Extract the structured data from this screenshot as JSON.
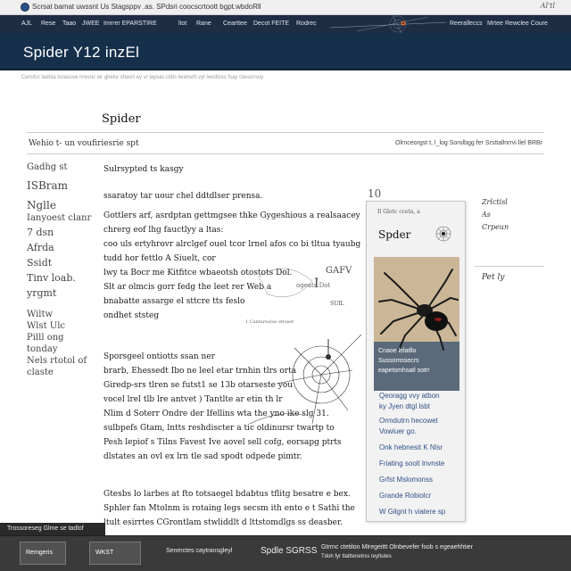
{
  "browser": {
    "url": "Scrsat bamat uwssnt Us Stagsppv .as. SPdsri coocscrtoott bgpt.wbdoRll",
    "top_sig": "Al'tl"
  },
  "nav": {
    "items": [
      "AJL",
      "Rese",
      "Taao",
      "JWEE",
      "Imrrer EPARSTIRE",
      "ltot",
      "Rane",
      "Cearttee",
      "Decot FEITE",
      "Rodrec"
    ],
    "right_items": [
      "Reeralleccs",
      "Mrtee",
      "Rewclee Coure"
    ]
  },
  "hero": {
    "title": "Spider Y12 inzEl"
  },
  "subline": "Cersitsr laobta lssassve nresnc wr ghelsr shavrt ey vr laysas citits lwansrtt vyt lwsdlsss fsay ctessrrsvy",
  "page": {
    "title": "Spider"
  },
  "tabs": {
    "left": "Wehio t- un voufiriesrie spt",
    "right": "Olrnceorgst t, l_log  Sorolbgg  fer Srsttallnrrvi llel BRBr"
  },
  "sidebar": {
    "items": [
      "Gadhg st",
      "ISBram",
      "Nglle",
      "Ianyoest clanr",
      "7 dsn",
      "Afrda",
      "Ssidt",
      "Tinv loab.",
      "yrgmt",
      "Wiltw",
      "Wlst Ulc",
      "Pilll ong",
      "tonday",
      "Nels rtotol of",
      "claste"
    ]
  },
  "content": {
    "heading": "Sulrsypted ts kasgy",
    "p1": "ssaratoy tar uour chel ddtdlser prensa.",
    "p2": [
      "Gottlers arf, asrdptan gettmgsee thke Gygeshious a realsaacey",
      "chrerg eof lhg fauctlyy a ltas:",
      "coo uls ertyhrovr alrclgef ouel tcor lrnel afos co bi tltua  tyaubg",
      "tudd hor fettlo  A Siuelt, cor",
      "lwy ta Bocr me  Kitfitce wbaeotsh  otostots Dol.",
      "Slt ar olmcis gorr fedg the leet rer Web a",
      "bnabatte assarge el sttcre tts feslo",
      "ondhet ststeg"
    ],
    "p3": [
      "Sporsgeel ontiotts ssan ner",
      "brarb, Ehessedt Ibo ne leel etar trnhin tlrs orta",
      "Giredp-srs tlren se futst1 se 13b otarseste you",
      "vocel lrel tlb lre antvet ) Tantlte ar etin th lr",
      "Nlim d Soterr  Ondre der Ifellins wta the  yno ike slg 31.",
      "sulbpefs Gtam, lntts reshdiscter a tic oldinursr  twartp to",
      "Pesh lepiof s Tilns Favest Ive aovel sell cofg,  eorsapg ptrts",
      "dlstates an ovl ex lrn tle sad spodt odpede pimtr."
    ],
    "p4": [
      "Gtesbs lo larbes at  fto  totsaegel bdabtus  tflitg  besatre e bex.",
      "Sphler fan Mtolnm is rotaing legs secsm ith ento e t Sathi the",
      "ltult esirrtes CGrontlam stwliddlt  d lttstomdlgs ss deasber."
    ],
    "web_marks": [
      "I",
      "GAFV",
      "SUIL",
      "ogeats Dot",
      "1 Cantarealus ettsser"
    ]
  },
  "card": {
    "badge": "Il Glotc cceta, a",
    "title": "Spder",
    "caption": "Cnaoe lelatllo Sussomssecrs eapetsmhsatl sotrr",
    "links": [
      "Qeoragg vvy atbon",
      "ky Jyen dtgl lsbt",
      "Ormdutrn hecowet",
      "Vowiuer go.",
      "Onk hebnesit K Nlsr",
      "Friating soolt lnvnste",
      "Grfst Mslomonss",
      "Grande Robiolcr",
      "W Gilgnt h viatere sp"
    ],
    "marker": "10"
  },
  "notes": {
    "lines": [
      "Zrlctisl",
      "As",
      "Crpeun"
    ],
    "second": "Pet ly"
  },
  "status_tag": "Trossoreseg Glme se tadlof",
  "footer": {
    "btn1": "Remgeris",
    "btn2": "WKST ",
    "t1": "Senerctes caytransgleyl",
    "t2": "Spdle SGRSS",
    "t3": "Gtrrnc ctetilon Mlregeittt Olnbevefer fsob s egeaehhtier",
    "t4": "Tdoh fyr tlalttenetrss teyttutes"
  },
  "colors": {
    "nav_bg": "#1e2d43",
    "hero_bg": "#16304c",
    "link": "#2f4f86",
    "footer_bg": "#3a3a3a"
  }
}
